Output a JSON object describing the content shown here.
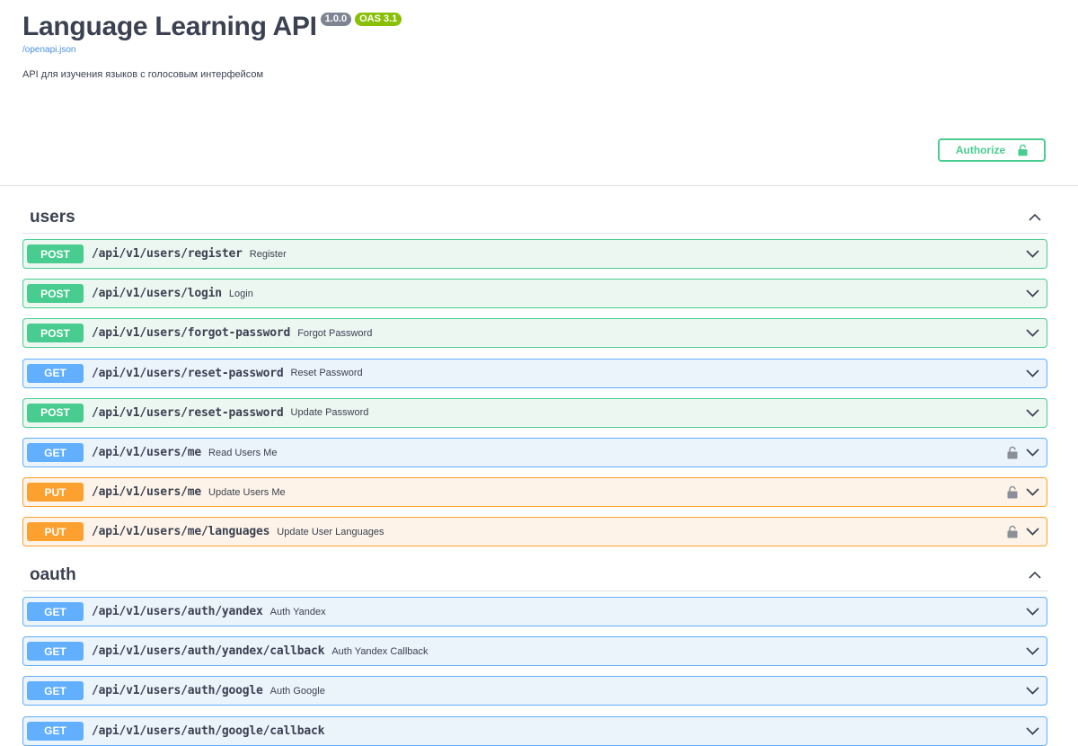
{
  "info": {
    "title": "Language Learning API",
    "version": "1.0.0",
    "oas": "OAS 3.1",
    "spec_link": "/openapi.json",
    "description": "API для изучения языков с голосовым интерфейсом",
    "authorize_label": "Authorize"
  },
  "colors": {
    "post": "#49cc90",
    "get": "#61affe",
    "put": "#fca130"
  },
  "sections": [
    {
      "title": "users",
      "operations": [
        {
          "method": "POST",
          "path": "/api/v1/users/register",
          "summary": "Register",
          "locked": false
        },
        {
          "method": "POST",
          "path": "/api/v1/users/login",
          "summary": "Login",
          "locked": false
        },
        {
          "method": "POST",
          "path": "/api/v1/users/forgot-password",
          "summary": "Forgot Password",
          "locked": false
        },
        {
          "method": "GET",
          "path": "/api/v1/users/reset-password",
          "summary": "Reset Password",
          "locked": false
        },
        {
          "method": "POST",
          "path": "/api/v1/users/reset-password",
          "summary": "Update Password",
          "locked": false
        },
        {
          "method": "GET",
          "path": "/api/v1/users/me",
          "summary": "Read Users Me",
          "locked": true
        },
        {
          "method": "PUT",
          "path": "/api/v1/users/me",
          "summary": "Update Users Me",
          "locked": true
        },
        {
          "method": "PUT",
          "path": "/api/v1/users/me/languages",
          "summary": "Update User Languages",
          "locked": true
        }
      ]
    },
    {
      "title": "oauth",
      "operations": [
        {
          "method": "GET",
          "path": "/api/v1/users/auth/yandex",
          "summary": "Auth Yandex",
          "locked": false
        },
        {
          "method": "GET",
          "path": "/api/v1/users/auth/yandex/callback",
          "summary": "Auth Yandex Callback",
          "locked": false
        },
        {
          "method": "GET",
          "path": "/api/v1/users/auth/google",
          "summary": "Auth Google",
          "locked": false
        },
        {
          "method": "GET",
          "path": "/api/v1/users/auth/google/callback",
          "summary": "",
          "locked": false
        }
      ]
    }
  ]
}
